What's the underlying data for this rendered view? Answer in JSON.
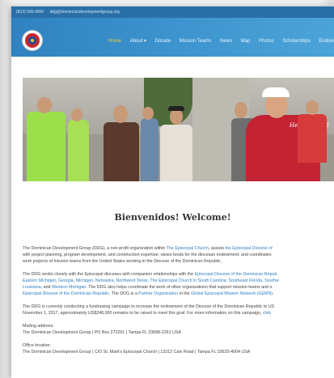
{
  "topbar": {
    "phone": "(813) 000-0000",
    "email": "ddg@dominicandevelopmentgroup.org"
  },
  "nav": {
    "items": [
      {
        "label": "Home",
        "active": true
      },
      {
        "label": "About ▾",
        "active": false
      },
      {
        "label": "Donate",
        "active": false
      },
      {
        "label": "Mission Teams",
        "active": false
      },
      {
        "label": "News",
        "active": false
      },
      {
        "label": "Map",
        "active": false
      },
      {
        "label": "Photos",
        "active": false
      },
      {
        "label": "Scholarships",
        "active": false
      },
      {
        "label": "Endow",
        "active": false
      }
    ]
  },
  "hero": {
    "shirt_text": "Hebrews 12:1"
  },
  "page": {
    "heading": "Bienvenidos! Welcome!"
  },
  "content": {
    "p1": {
      "a": "The Dominican Development Group (DDG), a non-profit organization within ",
      "l1": "The Episcopal Church",
      "b": ", assists ",
      "l2": "the Episcopal Diocese of",
      "c": "with project planning, program development, and construction expertise; raises funds for the diocesan endowment; and coordinates",
      "d": "work projects of mission teams from the United States working in the Diocese of the Dominican Republic."
    },
    "p2": {
      "a": "The DDG works closely with the Episcopal dioceses with companion relationships with the ",
      "l1": "Episcopal Diocese of the Dominican Repub",
      "l2": "Eastern Michigan",
      "b": ", ",
      "l3": "Georgia",
      "l4": "Michigan",
      "l5": "Nebraska",
      "l6": "Northwest Texas",
      "c": ", ",
      "l7": "The Episcopal Church in South Carolina",
      "l8": "Southeast Florida",
      "l9": "Southw",
      "l10": "Louisiana",
      "d": ", and ",
      "l11": "Western Michigan",
      "e": ". The DDG also helps coordinate the work of other organizations that support mission teams and o",
      "l12": "Episcopal Diocese of the Dominican Republic",
      "f": ". The DDG is a ",
      "l13": "Partner Organization",
      "g": " in the ",
      "l14": "Global Episcopal Mission Network (GEMN)",
      "h": "."
    },
    "p3": {
      "a": "The DDG is currently conducting a fundraising campaign to increase the endowment of the Diocese of the Dominican Republic to US",
      "b": "November 1, 2017, approximately US$248,000 remains to be raised to meet this goal. For more information on this campaign, ",
      "l1": "click"
    },
    "mailing_label": "Mailing address:",
    "mailing_value": "The Dominican Development Group | PO Box 272261 | Tampa FL 33688-2261 USA",
    "office_label": "Office location:",
    "office_value": "The Dominican Development Group | C/O St. Mark's Episcopal Church | 13312 Cain Road | Tampa FL 33625-4004 USA"
  }
}
